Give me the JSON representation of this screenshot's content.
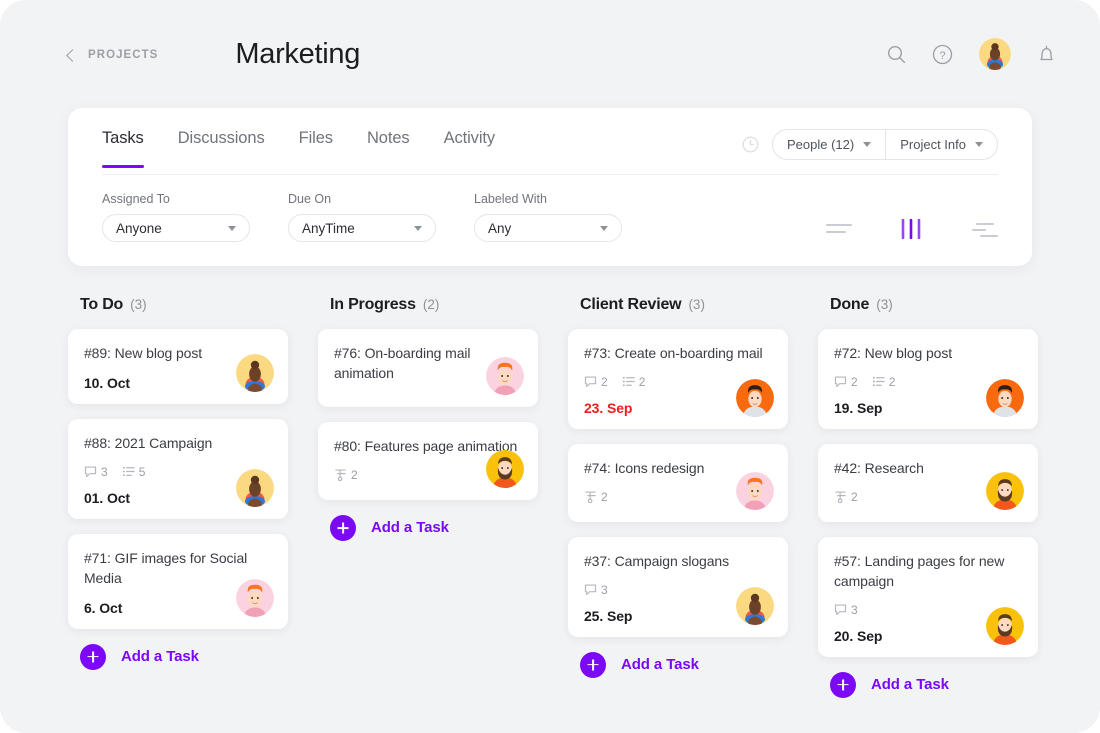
{
  "header": {
    "back_label": "PROJECTS",
    "title": "Marketing",
    "icons": {
      "search": "search-icon",
      "help": "help-circle-icon",
      "avatar": "user-avatar",
      "bell": "bell-icon"
    }
  },
  "panel": {
    "tabs": [
      {
        "label": "Tasks",
        "active": true
      },
      {
        "label": "Discussions",
        "active": false
      },
      {
        "label": "Files",
        "active": false
      },
      {
        "label": "Notes",
        "active": false
      },
      {
        "label": "Activity",
        "active": false
      }
    ],
    "clock_icon": "clock-icon",
    "people_label": "People (12)",
    "project_info_label": "Project Info",
    "filters": [
      {
        "label": "Assigned To",
        "value": "Anyone"
      },
      {
        "label": "Due On",
        "value": "AnyTime"
      },
      {
        "label": "Labeled With",
        "value": "Any"
      }
    ],
    "views": [
      {
        "name": "list-view",
        "active": false
      },
      {
        "name": "board-view",
        "active": true
      },
      {
        "name": "timeline-view",
        "active": false
      }
    ]
  },
  "accent": "#7b09f5",
  "overdue_color": "#f01d1d",
  "add_task_label": "Add a Task",
  "board": {
    "columns": [
      {
        "title": "To Do",
        "count": "(3)",
        "cards": [
          {
            "title": "#89: New blog post",
            "comments": null,
            "checklist": null,
            "subtasks": null,
            "date": "10. Oct",
            "overdue": false,
            "avatar": "woman-bun-cream"
          },
          {
            "title": "#88: 2021 Campaign",
            "comments": "3",
            "checklist": "5",
            "subtasks": null,
            "date": "01. Oct",
            "overdue": false,
            "avatar": "woman-bun-cream"
          },
          {
            "title": "#71: GIF images for Social Media",
            "comments": null,
            "checklist": null,
            "subtasks": null,
            "date": "6. Oct",
            "overdue": false,
            "avatar": "man-orange-hair-pink"
          }
        ]
      },
      {
        "title": "In Progress",
        "count": "(2)",
        "cards": [
          {
            "title": "#76: On-boarding mail animation",
            "comments": null,
            "checklist": null,
            "subtasks": null,
            "date": null,
            "overdue": false,
            "avatar": "man-orange-hair-pink"
          },
          {
            "title": "#80: Features page animation",
            "comments": null,
            "checklist": null,
            "subtasks": "2",
            "date": null,
            "overdue": false,
            "avatar": "bearded-man-yellow"
          }
        ]
      },
      {
        "title": "Client Review",
        "count": "(3)",
        "cards": [
          {
            "title": "#73: Create on-boarding mail",
            "comments": "2",
            "checklist": "2",
            "subtasks": null,
            "date": "23. Sep",
            "overdue": true,
            "avatar": "man-dark-hair-orange"
          },
          {
            "title": "#74: Icons redesign",
            "comments": null,
            "checklist": null,
            "subtasks": "2",
            "date": null,
            "overdue": false,
            "avatar": "man-orange-hair-pink"
          },
          {
            "title": "#37: Campaign slogans",
            "comments": "3",
            "checklist": null,
            "subtasks": null,
            "date": "25. Sep",
            "overdue": false,
            "avatar": "woman-bun-cream"
          }
        ]
      },
      {
        "title": "Done",
        "count": "(3)",
        "cards": [
          {
            "title": "#72: New blog post",
            "comments": "2",
            "checklist": "2",
            "subtasks": null,
            "date": "19. Sep",
            "overdue": false,
            "avatar": "man-dark-hair-orange"
          },
          {
            "title": "#42: Research",
            "comments": null,
            "checklist": null,
            "subtasks": "2",
            "date": null,
            "overdue": false,
            "avatar": "bearded-man-yellow"
          },
          {
            "title": "#57: Landing pages for new campaign",
            "comments": "3",
            "checklist": null,
            "subtasks": null,
            "date": "20. Sep",
            "overdue": false,
            "avatar": "bearded-man-yellow"
          }
        ]
      }
    ]
  }
}
